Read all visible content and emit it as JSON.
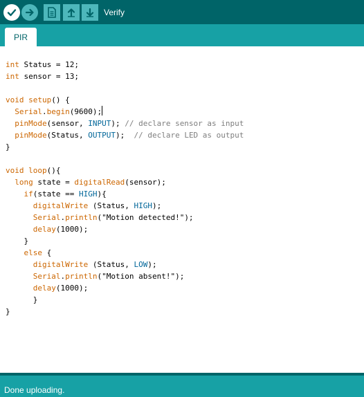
{
  "toolbar": {
    "verify_icon": "check-icon",
    "upload_icon": "arrow-right-icon",
    "new_icon": "new-file-icon",
    "open_icon": "arrow-up-icon",
    "save_icon": "arrow-down-icon",
    "hover_label": "Verify"
  },
  "tabs": [
    {
      "label": "PIR",
      "active": true
    }
  ],
  "status": {
    "message": "Done uploading."
  },
  "colors": {
    "toolbar_bg": "#006468",
    "tabbar_bg": "#17a1a5",
    "keyword": "#cc6600",
    "constant": "#006699",
    "comment": "#7e7e7e"
  },
  "code_lines": [
    [
      [
        "kw",
        "int"
      ],
      [
        "t",
        " Status = 12;"
      ]
    ],
    [
      [
        "kw",
        "int"
      ],
      [
        "t",
        " sensor = 13;"
      ]
    ],
    [],
    [
      [
        "kw",
        "void"
      ],
      [
        "t",
        " "
      ],
      [
        "fn",
        "setup"
      ],
      [
        "t",
        "() {"
      ]
    ],
    [
      [
        "t",
        "  "
      ],
      [
        "fn",
        "Serial"
      ],
      [
        "t",
        "."
      ],
      [
        "fn",
        "begin"
      ],
      [
        "t",
        "(9600);"
      ],
      [
        "caret",
        ""
      ]
    ],
    [
      [
        "t",
        "  "
      ],
      [
        "fn",
        "pinMode"
      ],
      [
        "t",
        "(sensor, "
      ],
      [
        "ct",
        "INPUT"
      ],
      [
        "t",
        "); "
      ],
      [
        "cm",
        "// declare sensor as input"
      ]
    ],
    [
      [
        "t",
        "  "
      ],
      [
        "fn",
        "pinMode"
      ],
      [
        "t",
        "(Status, "
      ],
      [
        "ct",
        "OUTPUT"
      ],
      [
        "t",
        ");  "
      ],
      [
        "cm",
        "// declare LED as output"
      ]
    ],
    [
      [
        "t",
        "}"
      ]
    ],
    [],
    [
      [
        "kw",
        "void"
      ],
      [
        "t",
        " "
      ],
      [
        "fn",
        "loop"
      ],
      [
        "t",
        "(){"
      ]
    ],
    [
      [
        "t",
        "  "
      ],
      [
        "kw",
        "long"
      ],
      [
        "t",
        " state = "
      ],
      [
        "fn",
        "digitalRead"
      ],
      [
        "t",
        "(sensor);"
      ]
    ],
    [
      [
        "t",
        "    "
      ],
      [
        "kw",
        "if"
      ],
      [
        "t",
        "(state == "
      ],
      [
        "ct",
        "HIGH"
      ],
      [
        "t",
        "){"
      ]
    ],
    [
      [
        "t",
        "      "
      ],
      [
        "fn",
        "digitalWrite"
      ],
      [
        "t",
        " (Status, "
      ],
      [
        "ct",
        "HIGH"
      ],
      [
        "t",
        ");"
      ]
    ],
    [
      [
        "t",
        "      "
      ],
      [
        "fn",
        "Serial"
      ],
      [
        "t",
        "."
      ],
      [
        "fn",
        "println"
      ],
      [
        "t",
        "(\"Motion detected!\");"
      ]
    ],
    [
      [
        "t",
        "      "
      ],
      [
        "fn",
        "delay"
      ],
      [
        "t",
        "(1000);"
      ]
    ],
    [
      [
        "t",
        "    }"
      ]
    ],
    [
      [
        "t",
        "    "
      ],
      [
        "kw",
        "else"
      ],
      [
        "t",
        " {"
      ]
    ],
    [
      [
        "t",
        "      "
      ],
      [
        "fn",
        "digitalWrite"
      ],
      [
        "t",
        " (Status, "
      ],
      [
        "ct",
        "LOW"
      ],
      [
        "t",
        ");"
      ]
    ],
    [
      [
        "t",
        "      "
      ],
      [
        "fn",
        "Serial"
      ],
      [
        "t",
        "."
      ],
      [
        "fn",
        "println"
      ],
      [
        "t",
        "(\"Motion absent!\");"
      ]
    ],
    [
      [
        "t",
        "      "
      ],
      [
        "fn",
        "delay"
      ],
      [
        "t",
        "(1000);"
      ]
    ],
    [
      [
        "t",
        "      }"
      ]
    ],
    [
      [
        "t",
        "}"
      ]
    ]
  ]
}
